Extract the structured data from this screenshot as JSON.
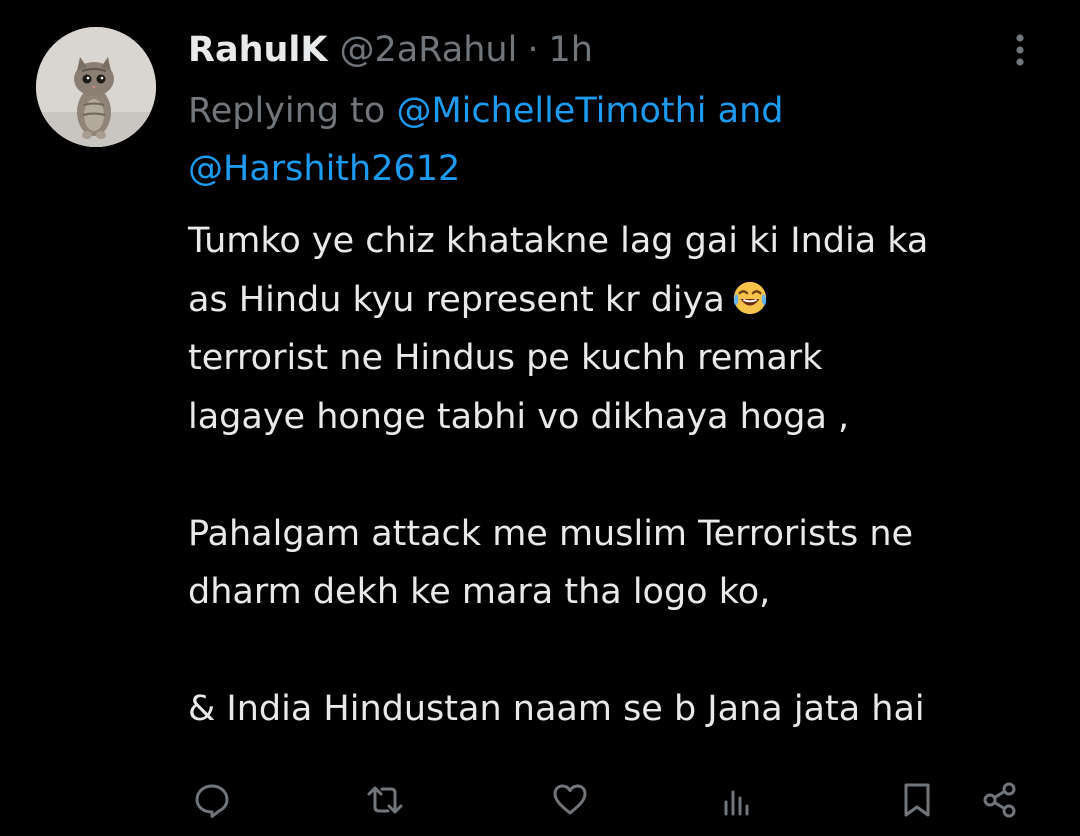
{
  "tweet": {
    "display_name": "RahulK",
    "handle": "@2aRahul",
    "separator": "·",
    "time": "1h",
    "replying_prefix": "Replying to",
    "mention_1": "@MichelleTimothi",
    "conjunction": "and",
    "mention_2": "@Harshith2612",
    "lines": [
      "Tumko ye chiz khatakne lag gai ki India ka",
      "as Hindu kyu represent kr diya",
      "terrorist ne Hindus pe kuchh remark",
      "lagaye honge tabhi vo dikhaya hoga ,",
      "",
      "Pahalgam attack me muslim Terrorists ne",
      "dharm dekh ke mara tha logo ko,",
      "",
      "& India Hindustan naam se b Jana jata hai"
    ],
    "emoji": "face-with-tears-of-joy"
  },
  "icons": {
    "more": "more-vertical-icon",
    "reply": "reply-icon",
    "retweet": "retweet-icon",
    "like": "heart-icon",
    "views": "views-icon",
    "bookmark": "bookmark-icon",
    "share": "share-icon"
  },
  "colors": {
    "background": "#000000",
    "text": "#e7e9ea",
    "muted": "#71767b",
    "link": "#1d9bf0"
  }
}
